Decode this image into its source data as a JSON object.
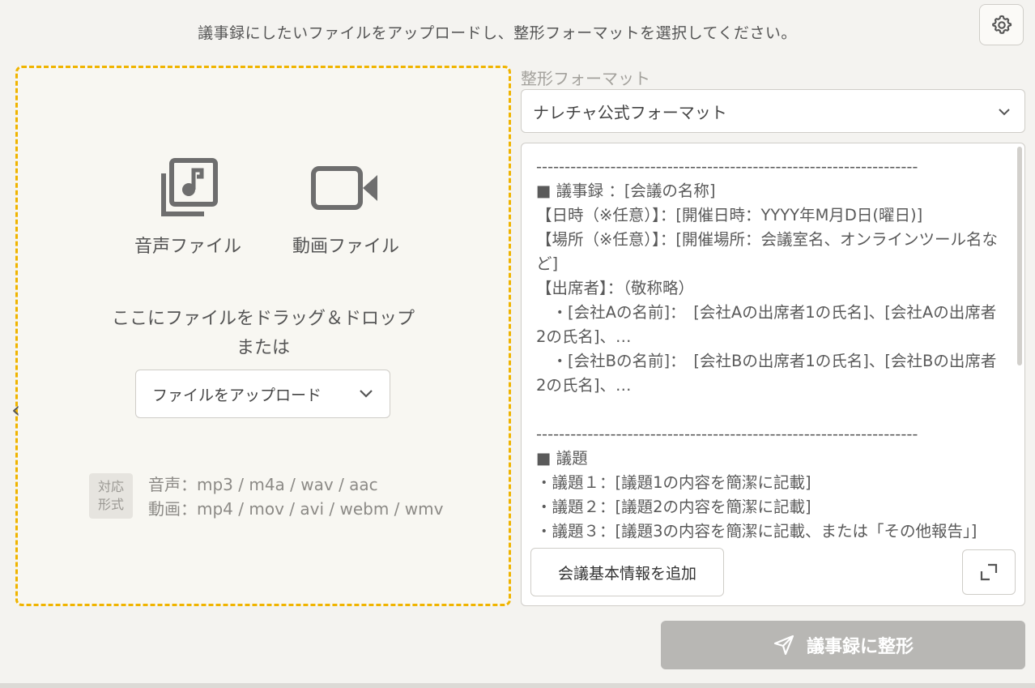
{
  "instruction": "議事録にしたいファイルをアップロードし、整形フォーマットを選択してください。",
  "upload": {
    "audio_label": "音声ファイル",
    "video_label": "動画ファイル",
    "drop_text": "ここにファイルをドラッグ＆ドロップ",
    "or_text": "または",
    "button_label": "ファイルをアップロード",
    "supported_badge_line1": "対応",
    "supported_badge_line2": "形式",
    "audio_formats": "音声：mp3 / m4a / wav / aac",
    "video_formats": "動画：mp4 / mov / avi / webm / wmv"
  },
  "format": {
    "label": "整形フォーマット",
    "selected": "ナレチャ公式フォーマット",
    "template": "-------------------------------------------------------------------\n■ 議事録 ：[会議の名称]\n【日時（※任意）】：[開催日時：YYYY年M月D日(曜日)]\n【場所（※任意）】：[開催場所：会議室名、オンラインツール名など]\n【出席者】：（敬称略）\n　・[会社Aの名前]：　[会社Aの出席者1の氏名]、[会社Aの出席者2の氏名]、…\n　・[会社Bの名前]：　[会社Bの出席者1の氏名]、[会社Bの出席者2の氏名]、…\n\n-------------------------------------------------------------------\n■ 議題\n・議題１：[議題1の内容を簡潔に記載]\n・議題２：[議題2の内容を簡潔に記載]\n・議題３：[議題3の内容を簡潔に記載、または「その他報告」]",
    "add_info_label": "会議基本情報を追加"
  },
  "submit_label": "議事録に整形",
  "icons": {
    "settings": "gear-icon",
    "audio": "music-library-icon",
    "video": "video-camera-icon",
    "dropdown": "chevron-down-icon",
    "expand": "expand-icon",
    "send": "send-icon"
  },
  "colors": {
    "dropzone_border": "#f0b400",
    "submit_disabled": "#b8b7b4"
  }
}
